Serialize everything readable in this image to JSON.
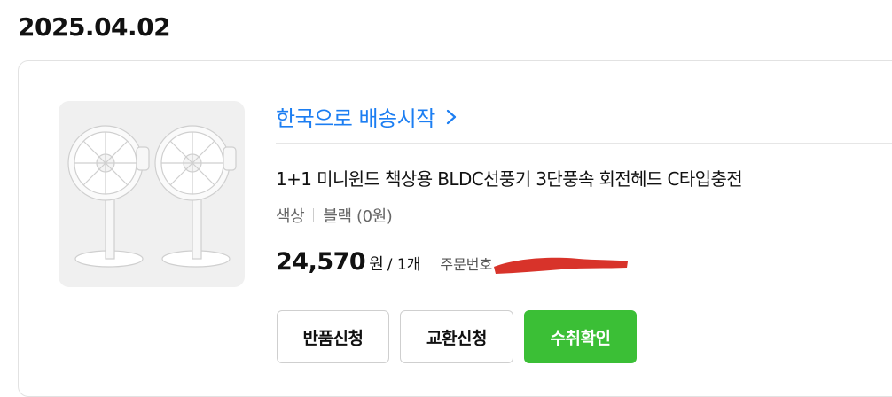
{
  "order_group": {
    "date": "2025.04.02"
  },
  "order": {
    "shipping_status": "한국으로 배송시작",
    "product_name": "1+1 미니윈드 책상용 BLDC선풍기 3단풍속 회전헤드 C타입충전",
    "option": {
      "label": "색상",
      "value": "블랙 (0원)"
    },
    "price": {
      "amount": "24,570",
      "unit": "원",
      "quantity": "/ 1개"
    },
    "order_number_label": "주문번호",
    "thumbnail_icon": "desk-fan-pair-image"
  },
  "actions": {
    "return_label": "반품신청",
    "exchange_label": "교환신청",
    "confirm_label": "수취확인"
  },
  "colors": {
    "link_blue": "#1c7ef2",
    "confirm_green": "#3bbf36",
    "redaction_red": "#d8332a"
  }
}
